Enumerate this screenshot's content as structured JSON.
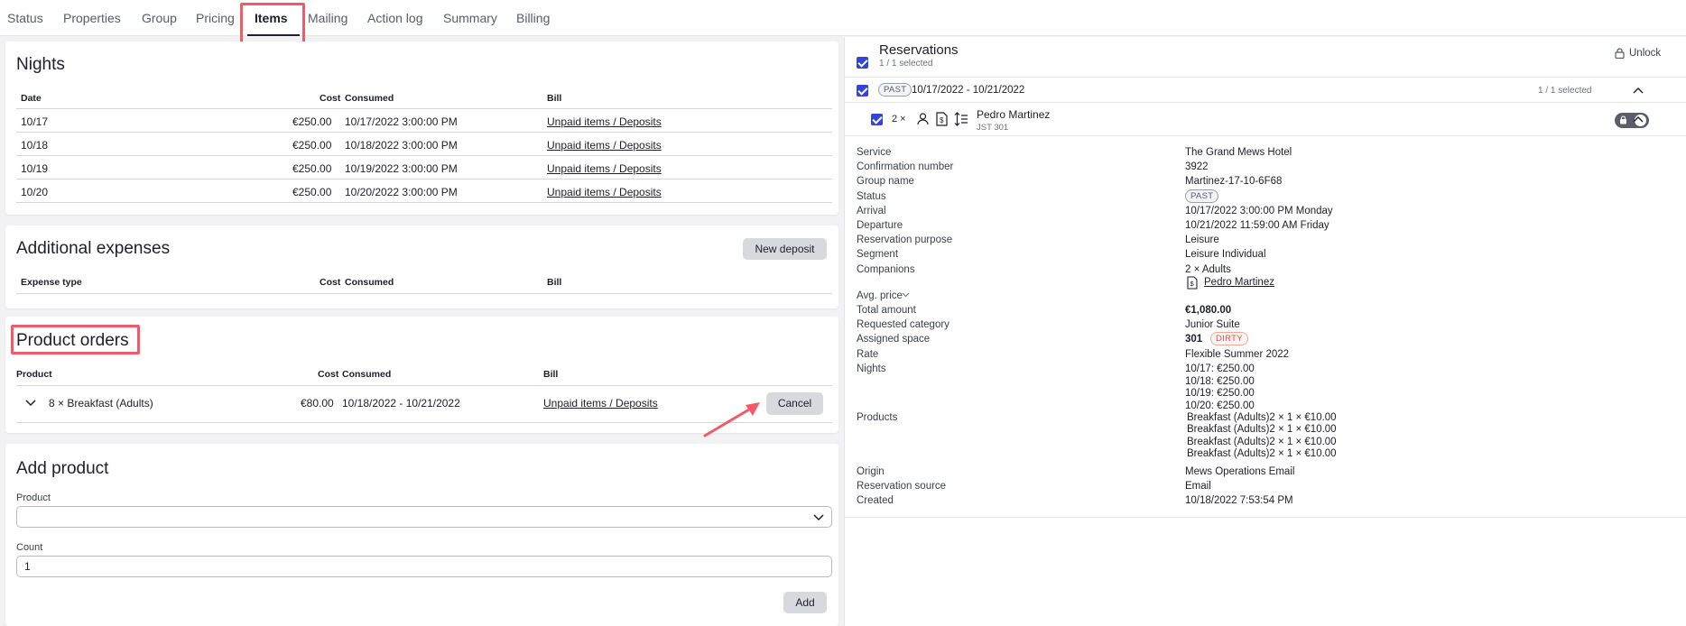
{
  "tabs": [
    "Status",
    "Properties",
    "Group",
    "Pricing",
    "Items",
    "Mailing",
    "Action log",
    "Summary",
    "Billing"
  ],
  "active_tab": "Items",
  "nights": {
    "title": "Nights",
    "headers": {
      "date": "Date",
      "cost": "Cost",
      "consumed": "Consumed",
      "bill": "Bill"
    },
    "rows": [
      {
        "date": "10/17",
        "cost": "€250.00",
        "consumed": "10/17/2022 3:00:00 PM",
        "bill": "Unpaid items / Deposits"
      },
      {
        "date": "10/18",
        "cost": "€250.00",
        "consumed": "10/18/2022 3:00:00 PM",
        "bill": "Unpaid items / Deposits"
      },
      {
        "date": "10/19",
        "cost": "€250.00",
        "consumed": "10/19/2022 3:00:00 PM",
        "bill": "Unpaid items / Deposits"
      },
      {
        "date": "10/20",
        "cost": "€250.00",
        "consumed": "10/20/2022 3:00:00 PM",
        "bill": "Unpaid items / Deposits"
      }
    ]
  },
  "expenses": {
    "title": "Additional expenses",
    "new_deposit_label": "New deposit",
    "headers": {
      "type": "Expense type",
      "cost": "Cost",
      "consumed": "Consumed",
      "bill": "Bill"
    }
  },
  "product_orders": {
    "title": "Product orders",
    "headers": {
      "product": "Product",
      "cost": "Cost",
      "consumed": "Consumed",
      "bill": "Bill"
    },
    "row": {
      "product": "8 × Breakfast (Adults)",
      "cost": "€80.00",
      "consumed": "10/18/2022 - 10/21/2022",
      "bill": "Unpaid items / Deposits"
    },
    "cancel_label": "Cancel"
  },
  "add_product": {
    "title": "Add product",
    "product_label": "Product",
    "product_value": "",
    "count_label": "Count",
    "count_value": "1",
    "add_label": "Add"
  },
  "reservations": {
    "title": "Reservations",
    "selected_text": "1 / 1 selected",
    "unlock_label": "Unlock",
    "group": {
      "status": "PAST",
      "dates": "10/17/2022 - 10/21/2022",
      "selected": "1 / 1 selected"
    },
    "guest": {
      "count": "2 ×",
      "name": "Pedro Martinez",
      "room": "JST 301"
    },
    "details": {
      "service_label": "Service",
      "service": "The Grand Mews Hotel",
      "confirmation_label": "Confirmation number",
      "confirmation": "3922",
      "group_name_label": "Group name",
      "group_name": "Martinez-17-10-6F68",
      "status_label": "Status",
      "status": "PAST",
      "arrival_label": "Arrival",
      "arrival": "10/17/2022 3:00:00 PM Monday",
      "departure_label": "Departure",
      "departure": "10/21/2022 11:59:00 AM Friday",
      "purpose_label": "Reservation purpose",
      "purpose": "Leisure",
      "segment_label": "Segment",
      "segment": "Leisure Individual",
      "companions_label": "Companions",
      "companions": "2 × Adults",
      "companion_name": "Pedro Martinez",
      "avg_price_label": "Avg. price",
      "total_label": "Total amount",
      "total": "€1,080.00",
      "req_category_label": "Requested category",
      "req_category": "Junior Suite",
      "assigned_label": "Assigned space",
      "assigned": "301",
      "assigned_status": "DIRTY",
      "rate_label": "Rate",
      "rate": "Flexible Summer 2022",
      "nights_label": "Nights",
      "nights": [
        "10/17: €250.00",
        "10/18: €250.00",
        "10/19: €250.00",
        "10/20: €250.00"
      ],
      "products_label": "Products",
      "products": [
        "Breakfast (Adults)2 × 1 × €10.00",
        "Breakfast (Adults)2 × 1 × €10.00",
        "Breakfast (Adults)2 × 1 × €10.00",
        "Breakfast (Adults)2 × 1 × €10.00"
      ],
      "origin_label": "Origin",
      "origin": "Mews Operations Email",
      "source_label": "Reservation source",
      "source": "Email",
      "created_label": "Created",
      "created": "10/18/2022 7:53:54 PM"
    }
  },
  "colors": {
    "accent": "#3245d6",
    "highlight": "#f15a67",
    "dirty": "#d9543b"
  }
}
